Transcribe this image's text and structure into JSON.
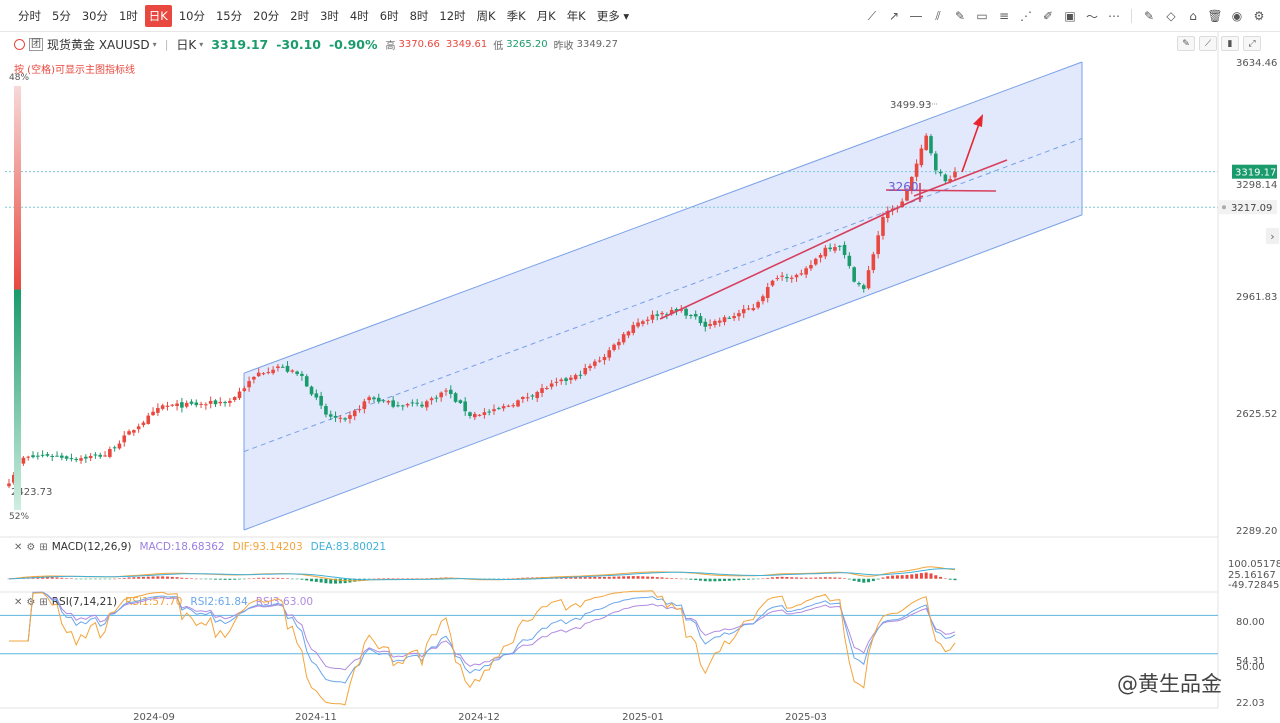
{
  "toolbar": {
    "timeframes": [
      "分时",
      "5分",
      "30分",
      "1时",
      "日K",
      "10分",
      "15分",
      "20分",
      "2时",
      "3时",
      "4时",
      "6时",
      "8时",
      "12时",
      "周K",
      "季K",
      "月K",
      "年K",
      "更多"
    ],
    "active": "日K"
  },
  "info": {
    "symbol_badge": "团",
    "name": "现货黄金 XAUUSD",
    "period": "日K",
    "price": "3319.17",
    "change": "-30.10",
    "change_pct": "-0.90%",
    "high_label": "高",
    "high": "3370.66",
    "open": "3349.61",
    "low_label": "低",
    "low": "3265.20",
    "prev_close_label": "昨收",
    "prev_close": "3349.27"
  },
  "hint": "按 (空格)可显示主图指标线",
  "watermark": "@黄生品金",
  "colors": {
    "up": "#e8483f",
    "down": "#1a9b6c",
    "channel_fill": "#dde5fb",
    "channel_line": "#7aa0e8",
    "trend_line": "#d6405e",
    "macd_dif": "#f3a43c",
    "macd_dea": "#3fb1d8",
    "rsi1": "#f3a43c",
    "rsi2": "#6aa6ea",
    "rsi3": "#b08be0",
    "price_badge": "#1a9b6c"
  },
  "chart_data": [
    {
      "type": "candlestick",
      "title": "现货黄金 XAUUSD 日K",
      "x_ticks": [
        "2024-09",
        "2024-11",
        "2024-12",
        "2025-01",
        "2025-03"
      ],
      "y_ticks": [
        "3634.46",
        "2961.83",
        "2625.52",
        "2289.20"
      ],
      "ylim": [
        2289.2,
        3634.46
      ],
      "price_labels": {
        "last": "3319.17",
        "last_overlap": "3298.14",
        "level": "3217.09"
      },
      "annotations": {
        "high_label": "3499.93",
        "low_label": "2423.73",
        "level_label": "3260"
      },
      "side_gauge": {
        "top_label": "48%",
        "bottom_label": "52%",
        "up_fraction": 0.48
      },
      "anchors": [
        {
          "i": 0,
          "close": 2430
        },
        {
          "i": 3,
          "close": 2495
        },
        {
          "i": 8,
          "close": 2505
        },
        {
          "i": 14,
          "close": 2495
        },
        {
          "i": 20,
          "close": 2505
        },
        {
          "i": 26,
          "close": 2580
        },
        {
          "i": 32,
          "close": 2645
        },
        {
          "i": 40,
          "close": 2650
        },
        {
          "i": 46,
          "close": 2660
        },
        {
          "i": 52,
          "close": 2740
        },
        {
          "i": 56,
          "close": 2760
        },
        {
          "i": 61,
          "close": 2730
        },
        {
          "i": 66,
          "close": 2620
        },
        {
          "i": 70,
          "close": 2600
        },
        {
          "i": 75,
          "close": 2670
        },
        {
          "i": 80,
          "close": 2650
        },
        {
          "i": 86,
          "close": 2650
        },
        {
          "i": 91,
          "close": 2690
        },
        {
          "i": 96,
          "close": 2620
        },
        {
          "i": 101,
          "close": 2630
        },
        {
          "i": 106,
          "close": 2660
        },
        {
          "i": 112,
          "close": 2700
        },
        {
          "i": 118,
          "close": 2730
        },
        {
          "i": 124,
          "close": 2790
        },
        {
          "i": 130,
          "close": 2880
        },
        {
          "i": 135,
          "close": 2910
        },
        {
          "i": 140,
          "close": 2920
        },
        {
          "i": 145,
          "close": 2880
        },
        {
          "i": 150,
          "close": 2900
        },
        {
          "i": 155,
          "close": 2930
        },
        {
          "i": 160,
          "close": 3020
        },
        {
          "i": 165,
          "close": 3020
        },
        {
          "i": 170,
          "close": 3100
        },
        {
          "i": 173,
          "close": 3110
        },
        {
          "i": 176,
          "close": 3010
        },
        {
          "i": 178,
          "close": 2980
        },
        {
          "i": 182,
          "close": 3190
        },
        {
          "i": 186,
          "close": 3230
        },
        {
          "i": 189,
          "close": 3340
        },
        {
          "i": 191,
          "close": 3420
        },
        {
          "i": 193,
          "close": 3330
        },
        {
          "i": 195,
          "close": 3290
        },
        {
          "i": 197,
          "close": 3319.17
        }
      ]
    },
    {
      "type": "bar",
      "title": "MACD(12,26,9)",
      "series": [
        {
          "name": "MACD",
          "value": "18.68362"
        },
        {
          "name": "DIF",
          "value": "93.14203"
        },
        {
          "name": "DEA",
          "value": "83.80021"
        }
      ],
      "y_ticks": [
        "100.05178",
        "25.16167",
        "-49.72845"
      ],
      "ylim": [
        -49.72845,
        100.05178
      ]
    },
    {
      "type": "line",
      "title": "RSI(7,14,21)",
      "series": [
        {
          "name": "RSI1",
          "value": "57.70"
        },
        {
          "name": "RSI2",
          "value": "61.84"
        },
        {
          "name": "RSI3",
          "value": "63.00"
        }
      ],
      "y_ticks": [
        "80.00",
        "54.31",
        "50.00",
        "22.03"
      ],
      "levels": [
        80,
        50
      ]
    }
  ]
}
